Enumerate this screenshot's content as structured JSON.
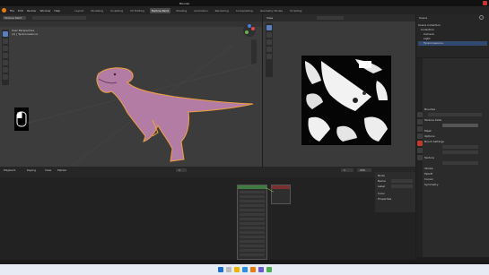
{
  "window": {
    "title": "Blender"
  },
  "menubar": {
    "items": [
      "File",
      "Edit",
      "Render",
      "Window",
      "Help"
    ],
    "workspaces": [
      "Layout",
      "Modeling",
      "Sculpting",
      "UV Editing",
      "Texture Paint",
      "Shading",
      "Animation",
      "Rendering",
      "Compositing",
      "Geometry Nodes",
      "Scripting"
    ],
    "active_workspace": "Texture Paint"
  },
  "viewport3d": {
    "mode": "Texture Paint",
    "view_label": "User Perspective",
    "object_label": "(1) | Tyrannosaurus"
  },
  "uv_editor": {
    "label": "Image Editor",
    "mode": "View"
  },
  "outliner": {
    "header": "Scene",
    "items": [
      "Scene Collection",
      "Collection",
      "Camera",
      "Light",
      "Tyrannosaurus"
    ]
  },
  "properties": {
    "panels": [
      "Brushes",
      "Texture Slots",
      "Mask",
      "Options",
      "Brush Settings",
      "Texture",
      "Stroke",
      "Falloff",
      "Cursor",
      "Symmetry"
    ]
  },
  "timeline": {
    "playback": "Playback",
    "keying": "Keying",
    "view": "View",
    "marker": "Marker",
    "frame": "1",
    "start": "1",
    "end": "250"
  },
  "shader": {
    "node_panel_title": "Node",
    "name_label": "Name",
    "label_label": "Label",
    "color_label": "Color",
    "properties_label": "Properties"
  },
  "colors": {
    "dino_fill": "#b27ca4",
    "dino_outline": "#f0a040",
    "active_tool": "#5680c2",
    "texture_bg": "#050505",
    "taskbar": "#e7ecf4"
  },
  "icons": [
    "search-icon",
    "gear-icon",
    "close-icon",
    "mouse-icon",
    "move-icon",
    "rotate-icon",
    "scale-icon",
    "brush-icon",
    "eye-icon",
    "camera-icon",
    "light-icon",
    "windows-start-icon"
  ]
}
